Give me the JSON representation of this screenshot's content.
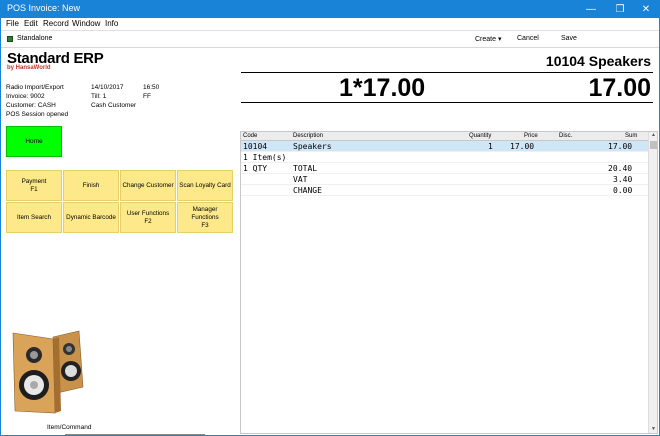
{
  "window": {
    "title": "POS Invoice: New",
    "min_glyph": "—",
    "max_glyph": "❐",
    "close_glyph": "✕"
  },
  "menu": [
    "File",
    "Edit",
    "Record",
    "Window",
    "Info"
  ],
  "toolbar": {
    "mode": "Standalone",
    "create": "Create ▾",
    "cancel": "Cancel",
    "save": "Save"
  },
  "logo": {
    "name": "Standard ERP",
    "by": "by HansaWorld"
  },
  "info": {
    "line1": "Radio Import/Export",
    "date": "14/10/2017",
    "time": "16:50",
    "invoice": "Invoice: 9002",
    "till": "Till: 1",
    "ff": "FF",
    "customer": "Customer: CASH",
    "customer_name": "Cash Customer",
    "session": "POS Session opened"
  },
  "display": {
    "item": "10104 Speakers",
    "qty_price": "1*17.00",
    "total": "17.00"
  },
  "buttons": {
    "home": "Home",
    "payment": [
      "Payment",
      "F1"
    ],
    "finish": "Finish",
    "change_customer": "Change Customer",
    "scan_loyalty": "Scan Loyalty Card",
    "item_search": "Item Search",
    "dynamic_barcode": "Dynamic Barcode",
    "user_functions": [
      "User Functions",
      "F2"
    ],
    "manager_functions": [
      "Manager",
      "Functions",
      "F3"
    ]
  },
  "command": {
    "label": "Item/Command",
    "value": ""
  },
  "grid": {
    "columns": {
      "code": "Code",
      "description": "Description",
      "quantity": "Quantity",
      "price": "Price",
      "disc": "Disc.",
      "sum": "Sum"
    },
    "rows": [
      {
        "code": "10104",
        "description": "Speakers",
        "quantity": "1",
        "price": "17.00",
        "disc": "",
        "sum": "17.00"
      },
      {
        "code": "1 Item(s)",
        "description": "",
        "quantity": "",
        "price": "",
        "disc": "",
        "sum": ""
      },
      {
        "code": "1 QTY",
        "description": "TOTAL",
        "quantity": "",
        "price": "",
        "disc": "",
        "sum": "20.40"
      },
      {
        "code": "",
        "description": "VAT",
        "quantity": "",
        "price": "",
        "disc": "",
        "sum": "3.40"
      },
      {
        "code": "",
        "description": "CHANGE",
        "quantity": "",
        "price": "",
        "disc": "",
        "sum": "0.00"
      }
    ]
  }
}
